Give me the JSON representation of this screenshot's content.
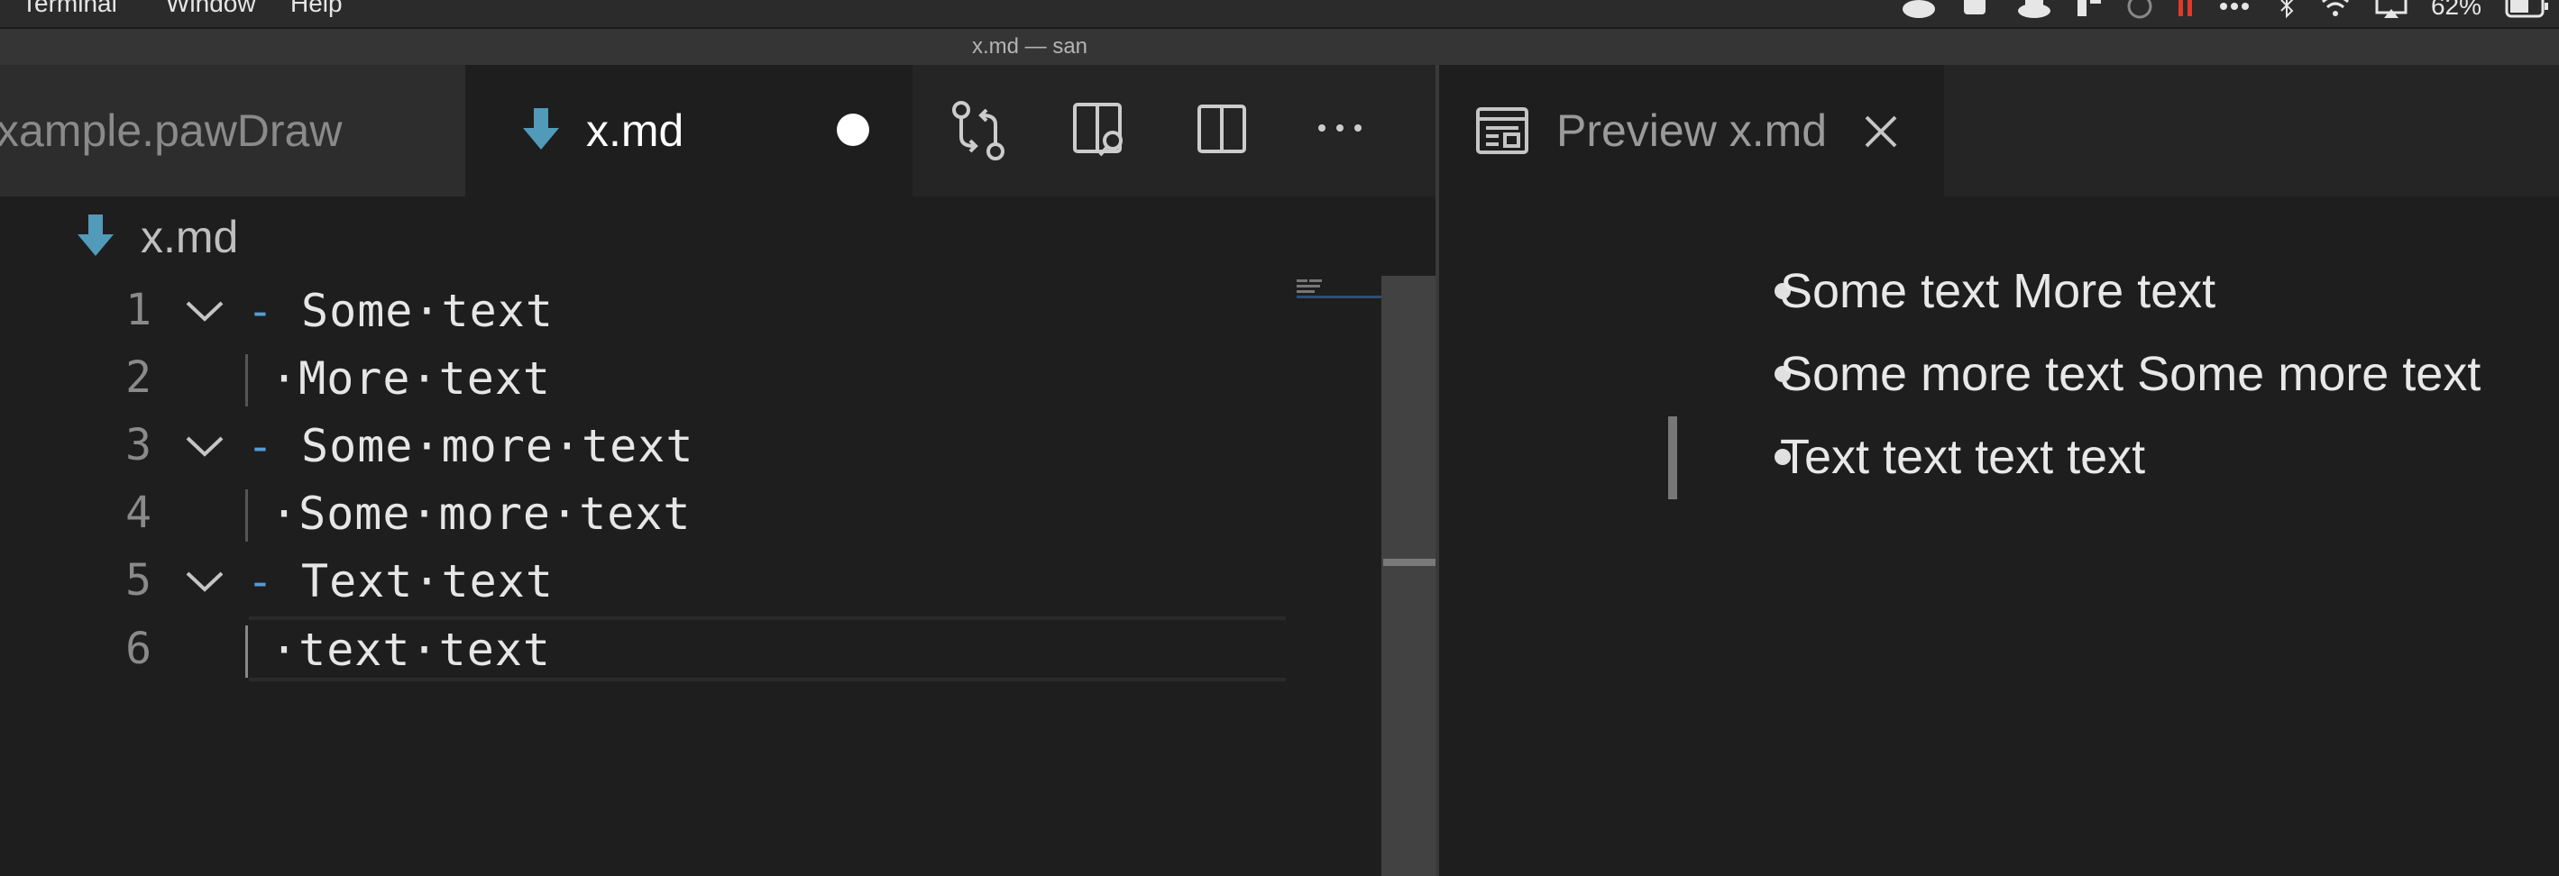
{
  "menubar": {
    "items": [
      "Terminal",
      "Window",
      "Help"
    ],
    "battery": "62%"
  },
  "window": {
    "title": "x.md — san"
  },
  "tabs": [
    {
      "label": "xample.pawDraw",
      "active": false
    },
    {
      "label": "x.md",
      "active": true,
      "dirty": true
    }
  ],
  "editor_actions": [
    "source-control-compare-icon",
    "open-preview-to-side-icon",
    "split-editor-icon",
    "more-actions-icon"
  ],
  "breadcrumb": {
    "file": "x.md"
  },
  "editor": {
    "lines": [
      {
        "number": "1",
        "foldable": true,
        "bullet": "-",
        "text": "Some·text"
      },
      {
        "number": "2",
        "foldable": false,
        "bullet": "",
        "text": "·More·text"
      },
      {
        "number": "3",
        "foldable": true,
        "bullet": "-",
        "text": "Some·more·text"
      },
      {
        "number": "4",
        "foldable": false,
        "bullet": "",
        "text": "·Some·more·text"
      },
      {
        "number": "5",
        "foldable": true,
        "bullet": "-",
        "text": "Text·text"
      },
      {
        "number": "6",
        "foldable": false,
        "bullet": "",
        "text": "·text·text"
      }
    ]
  },
  "preview": {
    "tab_label": "Preview x.md",
    "items": [
      "Some text More text",
      "Some more text Some more text",
      "Text text text text"
    ]
  },
  "colors": {
    "bullet_dash": "#569cd6",
    "md_icon": "#519aba",
    "background": "#1e1e1e"
  }
}
